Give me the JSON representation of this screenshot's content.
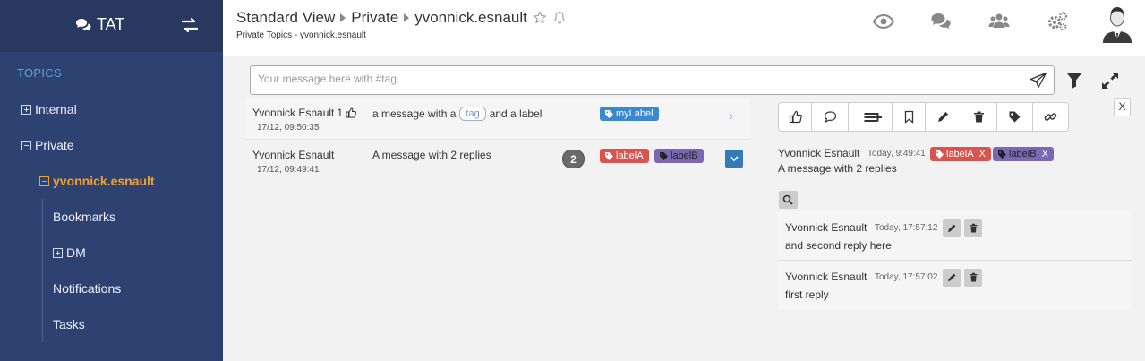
{
  "sidebar": {
    "brand": "TAT",
    "section_title": "TOPICS",
    "items": [
      {
        "label": "Internal"
      },
      {
        "label": "Private"
      },
      {
        "label": "yvonnick.esnault"
      },
      {
        "label": "Bookmarks"
      },
      {
        "label": "DM"
      },
      {
        "label": "Notifications"
      },
      {
        "label": "Tasks"
      }
    ]
  },
  "header": {
    "crumbs": [
      "Standard View",
      "Private",
      "yvonnick.esnault"
    ],
    "subtitle": "Private Topics - yvonnick.esnault",
    "icons": [
      "eye-icon",
      "comments-icon",
      "users-icon",
      "cogs-icon",
      "avatar"
    ]
  },
  "compose": {
    "placeholder": "Your message here with #tag"
  },
  "messages": [
    {
      "author": "Yvonnick Esnault",
      "like_count": "1",
      "date": "17/12, 09:50:35",
      "text_before": "a message with a",
      "tag": "tag",
      "text_after": "and a label",
      "labels": [
        {
          "text": "myLabel",
          "color": "#3a88d0"
        }
      ]
    },
    {
      "author": "Yvonnick Esnault",
      "date": "17/12, 09:49:41",
      "text": "A message with 2 replies",
      "reply_count": "2",
      "labels": [
        {
          "text": "labelA",
          "color": "#d9534f"
        },
        {
          "text": "labelB",
          "color": "#7b68b5"
        }
      ]
    }
  ],
  "detail": {
    "close_label": "X",
    "author": "Yvonnick Esnault",
    "time": "Today, 9:49:41",
    "text": "A message with 2 replies",
    "labels": [
      {
        "text": "labelA",
        "remove": "X",
        "color": "#d9534f"
      },
      {
        "text": "labelB",
        "remove": "X",
        "color": "#7b68b5"
      }
    ],
    "replies": [
      {
        "author": "Yvonnick Esnault",
        "time": "Today, 17:57:12",
        "text": "and second reply here"
      },
      {
        "author": "Yvonnick Esnault",
        "time": "Today, 17:57:02",
        "text": "first reply"
      }
    ]
  },
  "colors": {
    "sidebar_bg": "#2e4272",
    "sidebar_head_bg": "#28385f",
    "topics_accent": "#5aa4d8",
    "active_topic": "#f0a030"
  }
}
